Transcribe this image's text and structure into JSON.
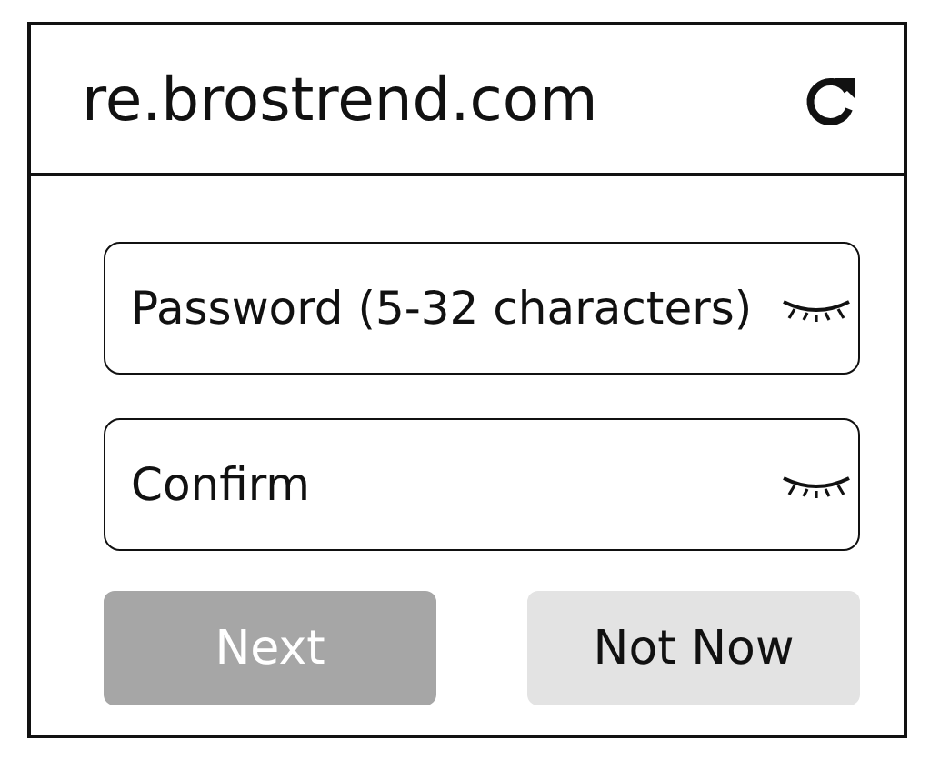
{
  "address_bar": {
    "url": "re.brostrend.com"
  },
  "fields": [
    {
      "placeholder": "Password (5-32 characters)"
    },
    {
      "placeholder": "Confirm"
    }
  ],
  "buttons": [
    {
      "label": "Next",
      "disabled": true
    },
    {
      "label": "Not Now",
      "disabled": false
    }
  ]
}
